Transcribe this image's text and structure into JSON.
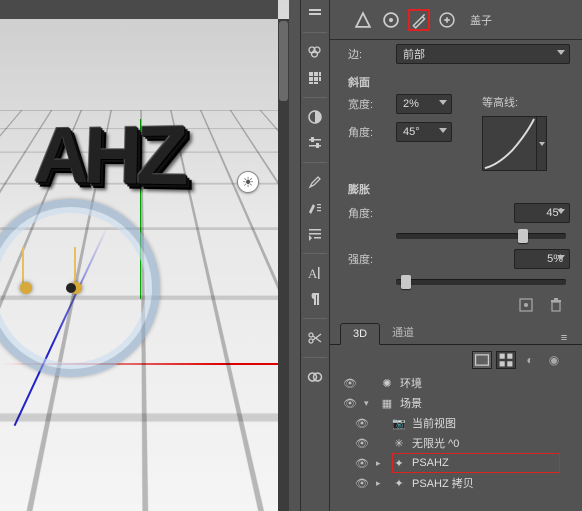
{
  "viewport_text": "AHZ",
  "top": {
    "cap_label": "盖子"
  },
  "edge": {
    "label": "边:",
    "value": "前部"
  },
  "bevel": {
    "section": "斜面",
    "width_label": "宽度:",
    "width_value": "2%",
    "angle_label": "角度:",
    "angle_value": "45°",
    "contour_label": "等高线:"
  },
  "inflate": {
    "section": "膨胀",
    "angle_label": "角度:",
    "angle_value": "45°",
    "strength_label": "强度:",
    "strength_value": "5%"
  },
  "tabs": {
    "t3d": "3D",
    "channels": "通道"
  },
  "layers": [
    {
      "name": "环境"
    },
    {
      "name": "场景"
    },
    {
      "name": "当前视图"
    },
    {
      "name": "无限光 ^0"
    },
    {
      "name": "PSAHZ"
    },
    {
      "name": "PSAHZ 拷贝"
    }
  ]
}
